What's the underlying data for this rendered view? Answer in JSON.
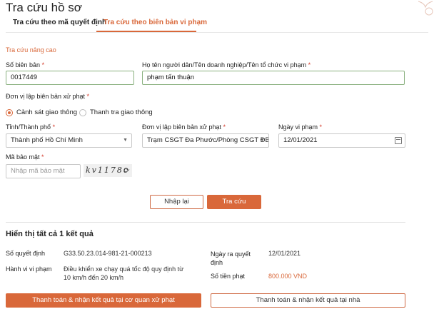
{
  "page": {
    "title": "Tra cứu hồ sơ"
  },
  "tabs": [
    {
      "label": "Tra cứu theo mã quyết định",
      "active": false
    },
    {
      "label": "Tra cứu theo biên bản vi phạm",
      "active": true
    }
  ],
  "advanced_label": "Tra cứu nâng cao",
  "form": {
    "record_number": {
      "label": "Số biên bản",
      "value": "0017449"
    },
    "person_name": {
      "label": "Họ tên người dân/Tên doanh nghiệp/Tên tổ chức vi phạm",
      "value": "phạm tấn thuận"
    },
    "issuing_unit_type": {
      "label": "Đơn vị lập biên bản xử phạt",
      "options": [
        {
          "label": "Cảnh sát giao thông",
          "selected": true
        },
        {
          "label": "Thanh tra giao thông",
          "selected": false
        }
      ]
    },
    "province": {
      "label": "Tỉnh/Thành phố",
      "value": "Thành phố Hồ Chí Minh"
    },
    "issuing_unit": {
      "label": "Đơn vị lập biên bản xử phạt",
      "value": "Trạm CSGT Đa Phước/Phòng CSGT ĐB-..."
    },
    "violation_date": {
      "label": "Ngày vi phạm",
      "value": "12/01/2021"
    },
    "security_code": {
      "label": "Mã bảo mật",
      "placeholder": "Nhập mã bảo mật",
      "captcha_text": "kv1178c"
    },
    "required_mark": "*"
  },
  "buttons": {
    "reset": "Nhập lại",
    "search": "Tra cứu"
  },
  "results": {
    "summary": "Hiển thị tất cả 1 kết quả",
    "decision_number": {
      "label": "Số quyết định",
      "value": "G33.50.23.014-981-21-000213"
    },
    "issue_date": {
      "label": "Ngày ra quyết định",
      "value": "12/01/2021"
    },
    "violation": {
      "label": "Hành vi vi phạm",
      "value": "Điều khiển xe chạy quá tốc độ quy định từ 10 km/h đến 20 km/h"
    },
    "fine": {
      "label": "Số tiền phạt",
      "value": "800.000 VND"
    }
  },
  "payment_buttons": {
    "at_agency": "Thanh toán & nhận kết quả tại cơ quan xử phạt",
    "at_home": "Thanh toán & nhận kết quả tại nhà"
  },
  "colors": {
    "accent": "#d9683a",
    "valid_border": "#8ab17f",
    "required": "#d43a2a"
  },
  "icons": [
    "calendar-icon",
    "refresh-icon",
    "chevron-down-icon"
  ]
}
